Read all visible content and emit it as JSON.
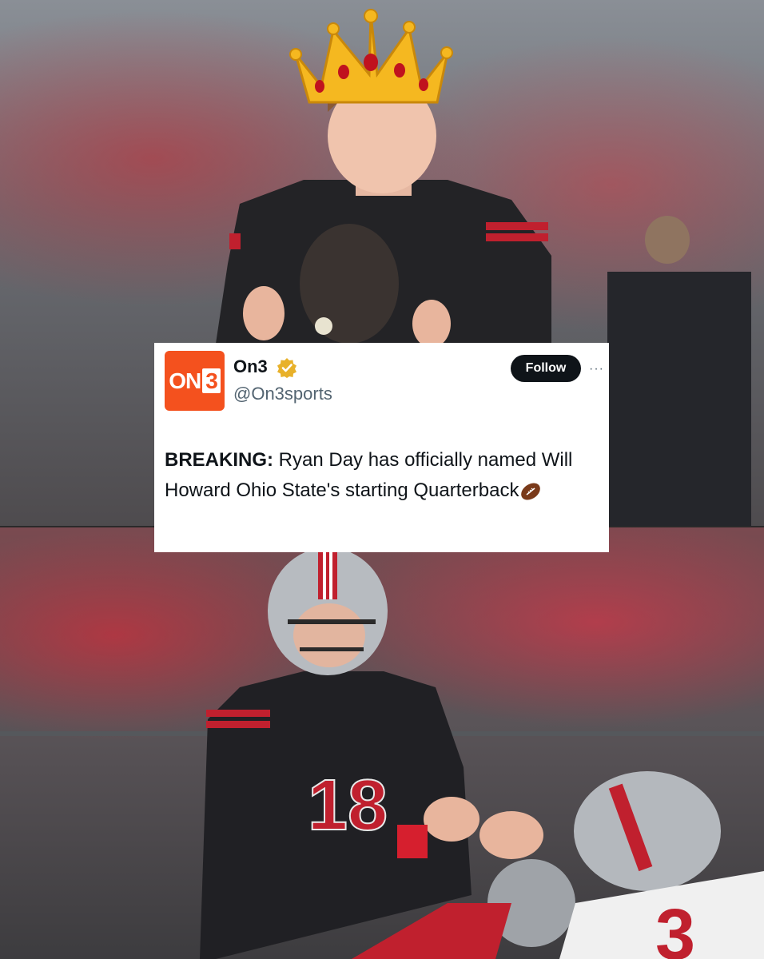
{
  "tweet": {
    "avatar_text_left": "ON",
    "avatar_text_right": "3",
    "display_name": "On3",
    "handle": "@On3sports",
    "follow_label": "Follow",
    "more_label": "···",
    "breaking_label": "BREAKING:",
    "text": " Ryan Day has officially named Will Howard Ohio State's starting Quarterback"
  },
  "icons": {
    "verified": "verified-badge-icon",
    "crown": "crown-emoji-icon",
    "football": "football-emoji-icon"
  },
  "colors": {
    "brand": "#f4511e",
    "follow_bg": "#0f1419",
    "verified": "#e8b12a"
  }
}
